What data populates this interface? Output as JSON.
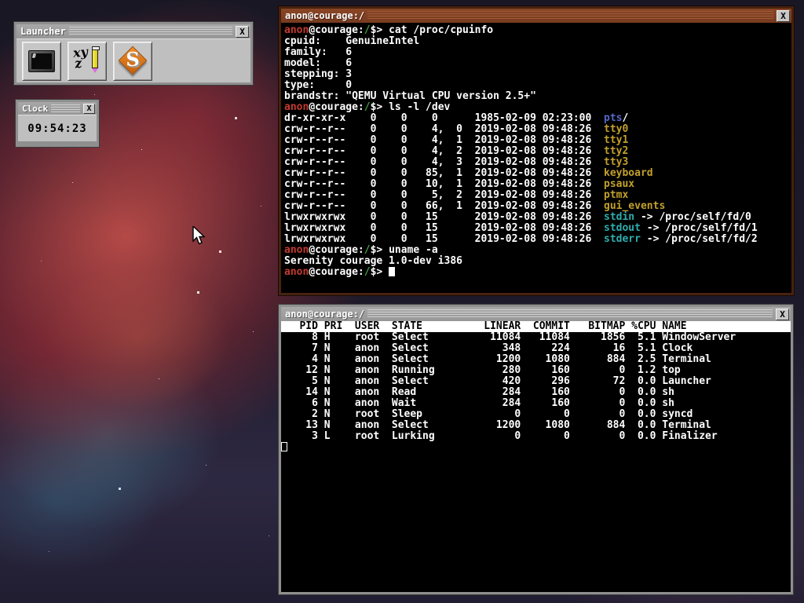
{
  "palette": {
    "r": "#c43a30",
    "w": "#ffffff",
    "g": "#3f9f3f",
    "y": "#c2a02c",
    "b": "#5468c8",
    "c": "#2fadad"
  },
  "launcher": {
    "title": "Launcher",
    "close_label": "X",
    "buttons": [
      {
        "name": "terminal",
        "icon": "terminal-icon",
        "glyph": "#"
      },
      {
        "name": "text-editor",
        "icon": "text-editor-icon",
        "glyph_top": "xy",
        "glyph_bottom": "z"
      },
      {
        "name": "serenity",
        "icon": "serenity-icon",
        "glyph": "S"
      }
    ]
  },
  "clock": {
    "title": "Clock",
    "close_label": "X",
    "time": "09:54:23"
  },
  "terminal": {
    "title": "anon@courage:/",
    "close_label": "X",
    "lines": [
      [
        [
          "anon",
          "r"
        ],
        [
          "@courage:",
          "w"
        ],
        [
          "/",
          "g"
        ],
        [
          "$> ",
          "w"
        ],
        [
          "cat /proc/cpuinfo",
          "w"
        ]
      ],
      [
        [
          "cpuid:    GenuineIntel",
          "w"
        ]
      ],
      [
        [
          "family:   6",
          "w"
        ]
      ],
      [
        [
          "model:    6",
          "w"
        ]
      ],
      [
        [
          "stepping: 3",
          "w"
        ]
      ],
      [
        [
          "type:     0",
          "w"
        ]
      ],
      [
        [
          "brandstr: \"QEMU Virtual CPU version 2.5+\"",
          "w"
        ]
      ],
      [
        [
          "anon",
          "r"
        ],
        [
          "@courage:",
          "w"
        ],
        [
          "/",
          "g"
        ],
        [
          "$> ",
          "w"
        ],
        [
          "ls -l /dev",
          "w"
        ]
      ],
      [
        [
          "dr-xr-xr-x    0    0    0      1985-02-09 02:23:00  ",
          "w"
        ],
        [
          "pts",
          "b"
        ],
        [
          "/",
          "w"
        ]
      ],
      [
        [
          "crw-r--r--    0    0    4,  0  2019-02-08 09:48:26  ",
          "w"
        ],
        [
          "tty0",
          "y"
        ]
      ],
      [
        [
          "crw-r--r--    0    0    4,  1  2019-02-08 09:48:26  ",
          "w"
        ],
        [
          "tty1",
          "y"
        ]
      ],
      [
        [
          "crw-r--r--    0    0    4,  2  2019-02-08 09:48:26  ",
          "w"
        ],
        [
          "tty2",
          "y"
        ]
      ],
      [
        [
          "crw-r--r--    0    0    4,  3  2019-02-08 09:48:26  ",
          "w"
        ],
        [
          "tty3",
          "y"
        ]
      ],
      [
        [
          "crw-r--r--    0    0   85,  1  2019-02-08 09:48:26  ",
          "w"
        ],
        [
          "keyboard",
          "y"
        ]
      ],
      [
        [
          "crw-r--r--    0    0   10,  1  2019-02-08 09:48:26  ",
          "w"
        ],
        [
          "psaux",
          "y"
        ]
      ],
      [
        [
          "crw-r--r--    0    0    5,  2  2019-02-08 09:48:26  ",
          "w"
        ],
        [
          "ptmx",
          "y"
        ]
      ],
      [
        [
          "crw-r--r--    0    0   66,  1  2019-02-08 09:48:26  ",
          "w"
        ],
        [
          "gui_events",
          "y"
        ]
      ],
      [
        [
          "lrwxrwxrwx    0    0   15      2019-02-08 09:48:26  ",
          "w"
        ],
        [
          "stdin",
          "c"
        ],
        [
          " -> /proc/self/fd/0",
          "w"
        ]
      ],
      [
        [
          "lrwxrwxrwx    0    0   15      2019-02-08 09:48:26  ",
          "w"
        ],
        [
          "stdout",
          "c"
        ],
        [
          " -> /proc/self/fd/1",
          "w"
        ]
      ],
      [
        [
          "lrwxrwxrwx    0    0   15      2019-02-08 09:48:26  ",
          "w"
        ],
        [
          "stderr",
          "c"
        ],
        [
          " -> /proc/self/fd/2",
          "w"
        ]
      ],
      [
        [
          "anon",
          "r"
        ],
        [
          "@courage:",
          "w"
        ],
        [
          "/",
          "g"
        ],
        [
          "$> ",
          "w"
        ],
        [
          "uname -a",
          "w"
        ]
      ],
      [
        [
          "Serenity courage 1.0-dev i386",
          "w"
        ]
      ],
      [
        [
          "anon",
          "r"
        ],
        [
          "@courage:",
          "w"
        ],
        [
          "/",
          "g"
        ],
        [
          "$> ",
          "w"
        ],
        [
          "",
          "curf"
        ]
      ]
    ]
  },
  "process_window": {
    "title": "anon@courage:/",
    "close_label": "X",
    "columns": [
      "PID",
      "PRI",
      "USER",
      "STATE",
      "LINEAR",
      "COMMIT",
      "BITMAP",
      "%CPU",
      "NAME"
    ],
    "header_text": "   PID PRI  USER  STATE          LINEAR  COMMIT   BITMAP %CPU NAME",
    "col_pad": {
      "pid": 6,
      "user": 6,
      "state": 15,
      "linear": 6,
      "commit": 8,
      "bitmap": 9,
      "cpu": 5
    },
    "rows": [
      [
        8,
        "H",
        "root",
        "Select",
        11084,
        11084,
        1856,
        "5.1",
        "WindowServer"
      ],
      [
        7,
        "N",
        "anon",
        "Select",
        348,
        224,
        16,
        "5.1",
        "Clock"
      ],
      [
        4,
        "N",
        "anon",
        "Select",
        1200,
        1080,
        884,
        "2.5",
        "Terminal"
      ],
      [
        12,
        "N",
        "anon",
        "Running",
        280,
        160,
        0,
        "1.2",
        "top"
      ],
      [
        5,
        "N",
        "anon",
        "Select",
        420,
        296,
        72,
        "0.0",
        "Launcher"
      ],
      [
        14,
        "N",
        "anon",
        "Read",
        284,
        160,
        0,
        "0.0",
        "sh"
      ],
      [
        6,
        "N",
        "anon",
        "Wait",
        284,
        160,
        0,
        "0.0",
        "sh"
      ],
      [
        2,
        "N",
        "root",
        "Sleep",
        0,
        0,
        0,
        "0.0",
        "syncd"
      ],
      [
        13,
        "N",
        "anon",
        "Select",
        1200,
        1080,
        884,
        "0.0",
        "Terminal"
      ],
      [
        3,
        "L",
        "root",
        "Lurking",
        0,
        0,
        0,
        "0.0",
        "Finalizer"
      ]
    ]
  }
}
